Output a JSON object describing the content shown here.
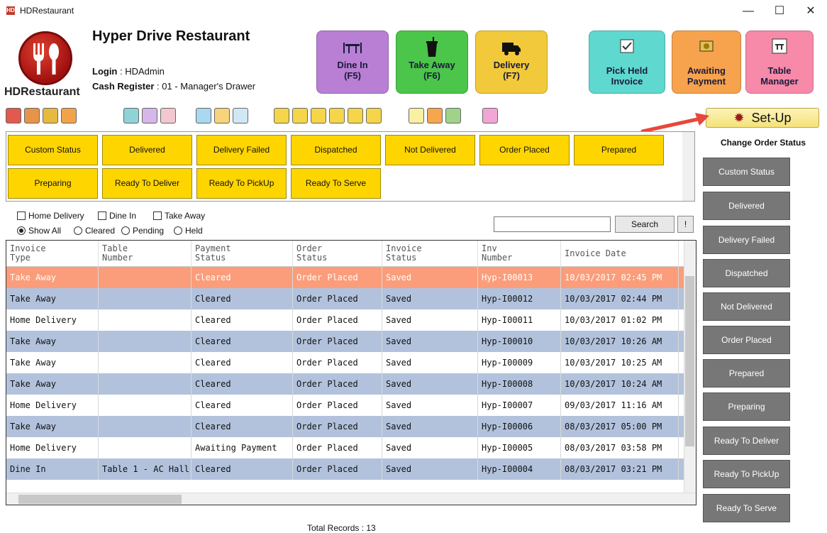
{
  "window": {
    "title": "HDRestaurant",
    "min": "—",
    "max": "☐",
    "close": "✕",
    "icon_text": "HD"
  },
  "header": {
    "logo_text": "HDRestaurant",
    "restaurant_name": "Hyper Drive  Restaurant",
    "login_label": "Login",
    "login_value": ": HDAdmin",
    "register_label": "Cash Register",
    "register_value": ": 01 - Manager's Drawer"
  },
  "big_buttons": {
    "dine_in": [
      "Dine In",
      "(F5)"
    ],
    "take_away": [
      "Take Away",
      "(F6)"
    ],
    "delivery": [
      "Delivery",
      "(F7)"
    ],
    "pick_held": [
      "Pick Held",
      "Invoice"
    ],
    "awaiting": [
      "Awaiting",
      "Payment"
    ],
    "table": [
      "Table",
      "Manager"
    ]
  },
  "setup_label": "Set-Up",
  "status_buttons": [
    "Custom Status",
    "Delivered",
    "Delivery Failed",
    "Dispatched",
    "Not Delivered",
    "Order Placed",
    "Prepared",
    "Preparing",
    "Ready To Deliver",
    "Ready To PickUp",
    "Ready To Serve"
  ],
  "filters": {
    "home_delivery": "Home Delivery",
    "dine_in": "Dine In",
    "take_away": "Take Away",
    "show_all": "Show All",
    "cleared": "Cleared",
    "pending": "Pending",
    "held": "Held"
  },
  "search": {
    "button": "Search",
    "extra": "!"
  },
  "grid": {
    "headers": [
      [
        "Invoice",
        "Type"
      ],
      [
        "Table",
        "Number"
      ],
      [
        "Payment",
        "Status"
      ],
      [
        "Order",
        "Status"
      ],
      [
        "Invoice",
        "Status"
      ],
      [
        "Inv",
        "Number"
      ],
      [
        "Invoice Date",
        ""
      ]
    ],
    "rows": [
      [
        "Take Away",
        "",
        "Cleared",
        "Order Placed",
        "Saved",
        "Hyp-I00013",
        "10/03/2017 02:45 PM"
      ],
      [
        "Take Away",
        "",
        "Cleared",
        "Order Placed",
        "Saved",
        "Hyp-I00012",
        "10/03/2017 02:44 PM"
      ],
      [
        "Home Delivery",
        "",
        "Cleared",
        "Order Placed",
        "Saved",
        "Hyp-I00011",
        "10/03/2017 01:02 PM"
      ],
      [
        "Take Away",
        "",
        "Cleared",
        "Order Placed",
        "Saved",
        "Hyp-I00010",
        "10/03/2017 10:26 AM"
      ],
      [
        "Take Away",
        "",
        "Cleared",
        "Order Placed",
        "Saved",
        "Hyp-I00009",
        "10/03/2017 10:25 AM"
      ],
      [
        "Take Away",
        "",
        "Cleared",
        "Order Placed",
        "Saved",
        "Hyp-I00008",
        "10/03/2017 10:24 AM"
      ],
      [
        "Home Delivery",
        "",
        "Cleared",
        "Order Placed",
        "Saved",
        "Hyp-I00007",
        "09/03/2017 11:16 AM"
      ],
      [
        "Take Away",
        "",
        "Cleared",
        "Order Placed",
        "Saved",
        "Hyp-I00006",
        "08/03/2017 05:00 PM"
      ],
      [
        "Home Delivery",
        "",
        "Awaiting Payment",
        "Order Placed",
        "Saved",
        "Hyp-I00005",
        "08/03/2017 03:58 PM"
      ],
      [
        "Dine In",
        "Table 1 - AC Hall",
        "Cleared",
        "Order Placed",
        "Saved",
        "Hyp-I00004",
        "08/03/2017 03:21 PM"
      ]
    ]
  },
  "total_records": "Total Records : 13",
  "change_order_status": {
    "title": "Change Order Status",
    "buttons": [
      "Custom Status",
      "Delivered",
      "Delivery Failed",
      "Dispatched",
      "Not Delivered",
      "Order Placed",
      "Prepared",
      "Preparing",
      "Ready To Deliver",
      "Ready To PickUp",
      "Ready To Serve"
    ]
  },
  "colors": {
    "status_yellow": "#ffd500",
    "row_alt": "#b2c2dc",
    "row_selected": "#fb9d7a",
    "side_button": "#777777"
  }
}
